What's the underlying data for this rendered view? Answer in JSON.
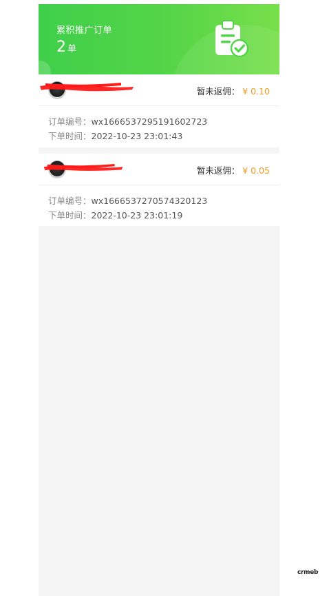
{
  "header": {
    "title": "累积推广订单",
    "count": "2",
    "unit": "单",
    "icon": "clipboard-check-icon"
  },
  "orders": [
    {
      "rebate_label": "暂未返佣：",
      "rebate_amount": "¥ 0.10",
      "order_no_label": "订单编号：",
      "order_no": "wx1666537295191602723",
      "time_label": "下单时间：",
      "time": "2022-10-23 23:01:43"
    },
    {
      "rebate_label": "暂未返佣：",
      "rebate_amount": "¥ 0.05",
      "order_no_label": "订单编号：",
      "order_no": "wx1666537270574320123",
      "time_label": "下单时间：",
      "time": "2022-10-23 23:01:19"
    }
  ],
  "brand": "crmeb",
  "colors": {
    "header_green": "#4fd24a",
    "amount_orange": "#f39a1e",
    "redaction_red": "#ff1a1a"
  }
}
